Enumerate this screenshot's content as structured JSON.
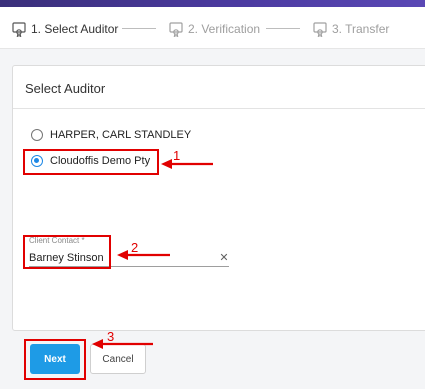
{
  "stepper": {
    "steps": [
      {
        "label": "1. Select Auditor",
        "state": "active",
        "icon": "certificate-icon"
      },
      {
        "label": "2. Verification",
        "state": "inactive",
        "icon": "certificate-icon"
      },
      {
        "label": "3. Transfer",
        "state": "inactive",
        "icon": "certificate-icon"
      }
    ]
  },
  "card": {
    "title": "Select Auditor",
    "options": [
      {
        "label": "HARPER, CARL STANDLEY",
        "checked": false
      },
      {
        "label": "Cloudoffis Demo Pty",
        "checked": true
      }
    ]
  },
  "client_contact": {
    "label": "Client Contact *",
    "value": "Barney Stinson",
    "clear_icon": "close-icon"
  },
  "buttons": {
    "next": "Next",
    "cancel": "Cancel"
  },
  "annotations": {
    "markers": [
      "1",
      "2",
      "3"
    ],
    "color": "#e10000"
  },
  "colors": {
    "accent": "#1e9be6",
    "header": "#3a2f7a"
  }
}
